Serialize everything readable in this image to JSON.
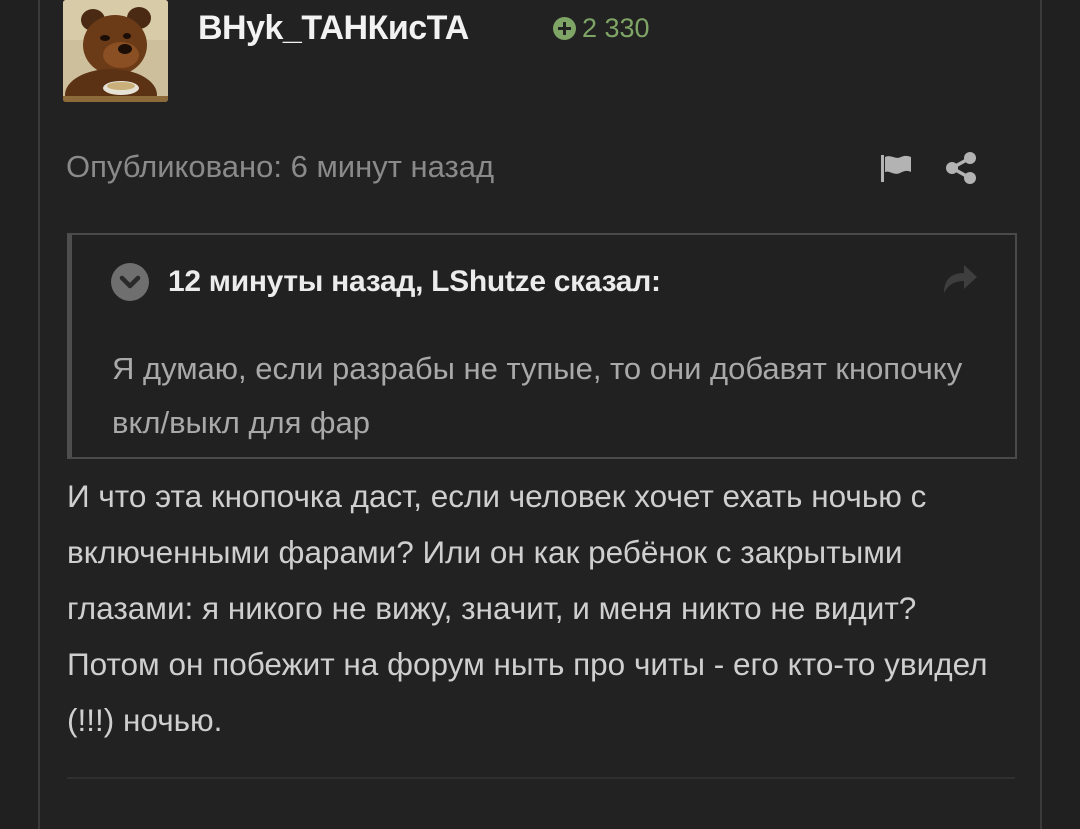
{
  "author": {
    "name": "ВНуk_ТАНКисТА",
    "reputation": "2 330"
  },
  "post": {
    "published": "Опубликовано: 6 минут назад",
    "body": "И что эта кнопочка даст, если человек хочет ехать ночью с включенными фарами? Или он как ребёнок с закрытыми глазами: я никого не вижу, значит, и меня никто не видит? Потом он побежит на форум ныть про читы - его кто-то увидел (!!!) ночью."
  },
  "quote": {
    "header": "12 минуты назад, LShutze сказал:",
    "body": "Я думаю, если разрабы не тупые, то они добавят кнопочку вкл/выкл для фар"
  },
  "icons": {
    "reputation": "plus-circle-icon",
    "report": "flag-icon",
    "share": "share-icon",
    "quote_toggle": "chevron-down-icon",
    "quote_goto": "share-arrow-icon"
  },
  "colors": {
    "background": "#202020",
    "reputation": "#7fa566",
    "muted_text": "#8a8a8a",
    "body_text": "#cfcfcf"
  }
}
